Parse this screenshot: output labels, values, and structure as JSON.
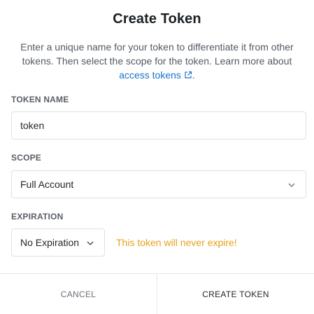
{
  "dialog": {
    "title": "Create Token",
    "description_text": "Enter a unique name for your token to differentiate it from other tokens. Then select the scope for the token. Learn more about",
    "description_link": "access tokens",
    "description_end": "."
  },
  "token_name": {
    "label": "TOKEN NAME",
    "value": "token"
  },
  "scope": {
    "label": "SCOPE",
    "selected": "Full Account"
  },
  "expiration": {
    "label": "EXPIRATION",
    "selected": "No Expiration",
    "warning": "This token will never expire!"
  },
  "footer": {
    "cancel_label": "CANCEL",
    "create_label": "CREATE TOKEN"
  },
  "colors": {
    "link": "#1a73c8",
    "warning": "#e7a11d"
  },
  "icons": {
    "external_link": "external-link-icon",
    "dropdown": "chevron-down-icon"
  }
}
